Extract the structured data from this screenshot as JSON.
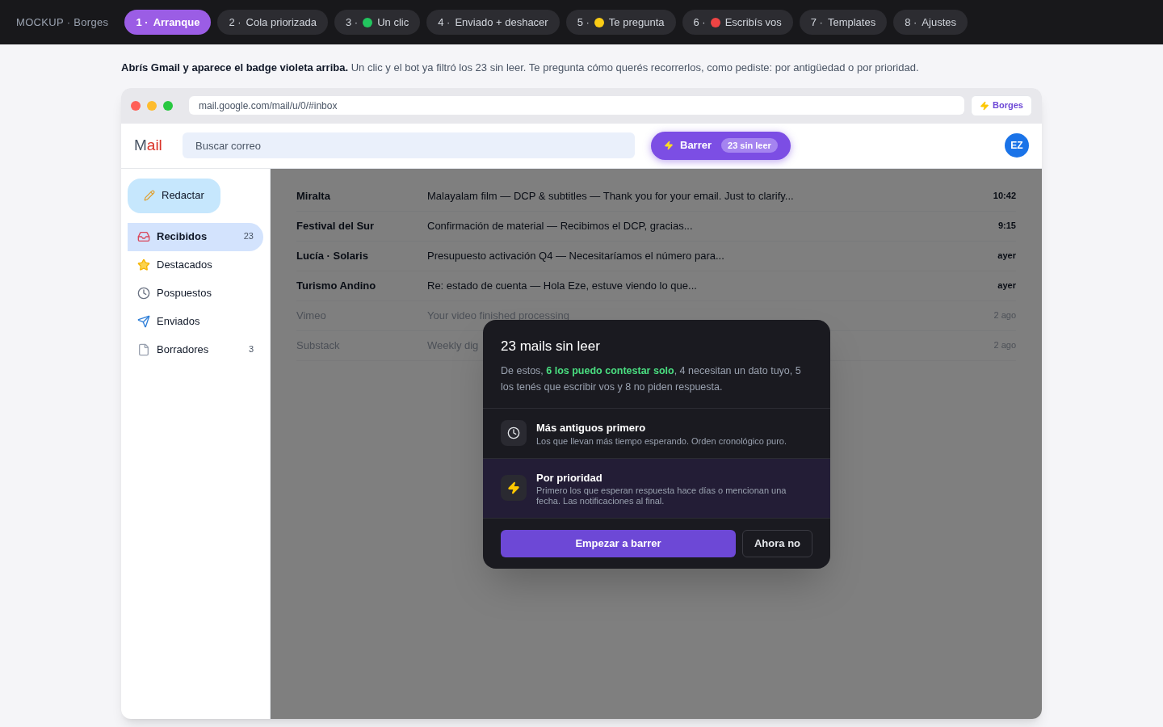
{
  "topbar": {
    "brand": "MOCKUP · Borges",
    "tabs": [
      {
        "number": "1 ·",
        "label": "Arranque",
        "selected": true
      },
      {
        "number": "2 ·",
        "label": "Cola priorizada",
        "selected": false
      },
      {
        "number": "3 ·",
        "label": "Un clic",
        "color": "#22c55e",
        "selected": false
      },
      {
        "number": "4 ·",
        "label": "Enviado + deshacer",
        "selected": false
      },
      {
        "number": "5 ·",
        "label": "Te pregunta",
        "color": "#facc15",
        "selected": false
      },
      {
        "number": "6 ·",
        "label": "Escribís vos",
        "color": "#ef4444",
        "selected": false
      },
      {
        "number": "7 ·",
        "label": "Templates",
        "selected": false
      },
      {
        "number": "8 ·",
        "label": "Ajustes",
        "selected": false
      }
    ]
  },
  "caption": "**Abrís Gmail y aparece el badge violeta arriba.** Un clic y el bot ya filtró los 23 sin leer. Te pregunta cómo querés recorrerlos, como pediste: por antigüedad o por prioridad.",
  "browser": {
    "url": "mail.google.com/mail/u/0/#inbox",
    "extension": "Borges"
  },
  "mail": {
    "logo": "Mail",
    "search": {
      "placeholder": "Buscar correo"
    },
    "sweep_button": {
      "label": "Barrer",
      "badge": "23 sin leer"
    },
    "avatar": "EZ",
    "compose": "Redactar",
    "folders": [
      {
        "kind": "inbox",
        "label": "Recibidos",
        "count": "23",
        "selected": true
      },
      {
        "kind": "star",
        "label": "Destacados",
        "selected": false
      },
      {
        "kind": "clock",
        "label": "Pospuestos",
        "selected": false
      },
      {
        "kind": "sent",
        "label": "Enviados",
        "selected": false
      },
      {
        "kind": "draft",
        "label": "Borradores",
        "count": "3",
        "selected": false
      }
    ],
    "messages": [
      {
        "sender": "Miralta",
        "subject": "Malayalam film — DCP & subtitles — Thank you for your email. Just to clarify...",
        "time": "10:42",
        "unread": true
      },
      {
        "sender": "Festival del Sur",
        "subject": "Confirmación de material — Recibimos el DCP, gracias...",
        "time": "9:15",
        "unread": true
      },
      {
        "sender": "Lucía · Solaris",
        "subject": "Presupuesto activación Q4 — Necesitaríamos el número para...",
        "time": "ayer",
        "unread": true
      },
      {
        "sender": "Turismo Andino",
        "subject": "Re: estado de cuenta — Hola Eze, estuve viendo lo que...",
        "time": "ayer",
        "unread": true
      },
      {
        "sender": "Vimeo",
        "subject": "Your video finished processing",
        "time": "2 ago",
        "unread": false
      },
      {
        "sender": "Substack",
        "subject": "Weekly dig",
        "time": "2 ago",
        "unread": false
      }
    ]
  },
  "dialog": {
    "title": "23 mails sin leer",
    "summary": "De estos, **6 los puedo contestar solo**, 4 necesitan un dato tuyo, 5 los tenés que escribir vos y 8 no piden respuesta.",
    "options": [
      {
        "kind": "clock",
        "title": "Más antiguos primero",
        "description": "Los que llevan más tiempo esperando. Orden cronológico puro.",
        "selected": false
      },
      {
        "kind": "bolt",
        "title": "Por prioridad",
        "description": "Primero los que esperan respuesta hace días o mencionan una fecha. Las notificaciones al final.",
        "selected": true
      }
    ],
    "primary": "Empezar a barrer",
    "secondary": "Ahora no"
  }
}
